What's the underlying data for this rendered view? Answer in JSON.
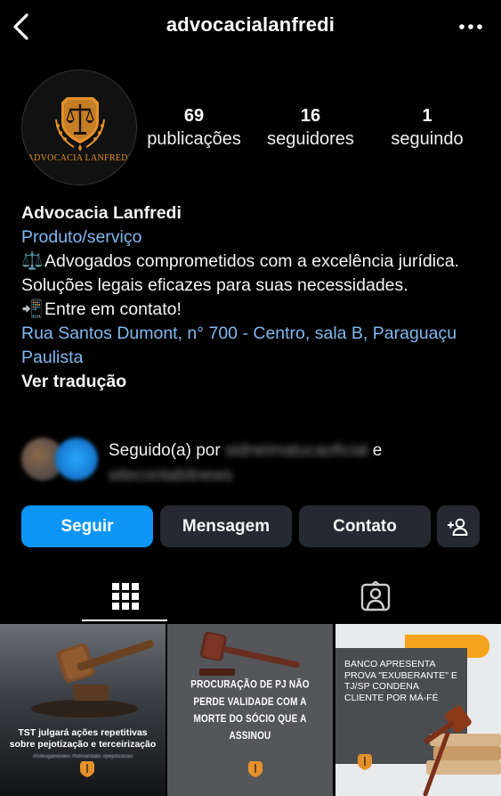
{
  "header": {
    "username": "advocacialanfredi",
    "back_icon": "chevron-left-icon",
    "more_icon": "more-horizontal-icon"
  },
  "profile": {
    "avatar_text": "ADVOCACIA LANFREDI",
    "stats": {
      "posts_count": "69",
      "posts_label": "publicações",
      "followers_count": "16",
      "followers_label": "seguidores",
      "following_count": "1",
      "following_label": "seguindo"
    }
  },
  "bio": {
    "name": "Advocacia Lanfredi",
    "category": "Produto/serviço",
    "line1": "Advogados comprometidos com a excelência jurídica. Soluções legais eficazes para suas necessidades.",
    "line2": "Entre em contato!",
    "address": "Rua Santos Dumont, n° 700 - Centro, sala B, Paraguaçu Paulista",
    "translate": "Ver tradução",
    "emoji1": "⚖️",
    "emoji2": "📲"
  },
  "followed_by": {
    "prefix": "Seguido(a) por",
    "user1": "sidneimatucaoficial",
    "connector": "e",
    "user2": "sitecontabilnews"
  },
  "actions": {
    "follow": "Seguir",
    "message": "Mensagem",
    "contact": "Contato",
    "add_user_icon": "add-user-icon"
  },
  "tabs": {
    "grid_icon": "grid-icon",
    "tagged_icon": "tagged-person-icon"
  },
  "posts": [
    {
      "caption": "TST julgará ações repetitivas sobre pejotização e terceirização",
      "tags": "#tsteugandoleis #tstmandato #pejotizacao"
    },
    {
      "caption": "PROCURAÇÃO DE PJ NÃO PERDE VALIDADE COM A MORTE DO SÓCIO QUE A ASSINOU"
    },
    {
      "caption": "BANCO APRESENTA PROVA \"EXUBERANTE\" E TJ/SP CONDENA CLIENTE POR MÁ-FÉ"
    }
  ],
  "colors": {
    "accent_blue": "#0d95f6",
    "link_blue": "#7fb8ef",
    "brand_orange": "#e3912b",
    "button_gray": "#262a30"
  }
}
